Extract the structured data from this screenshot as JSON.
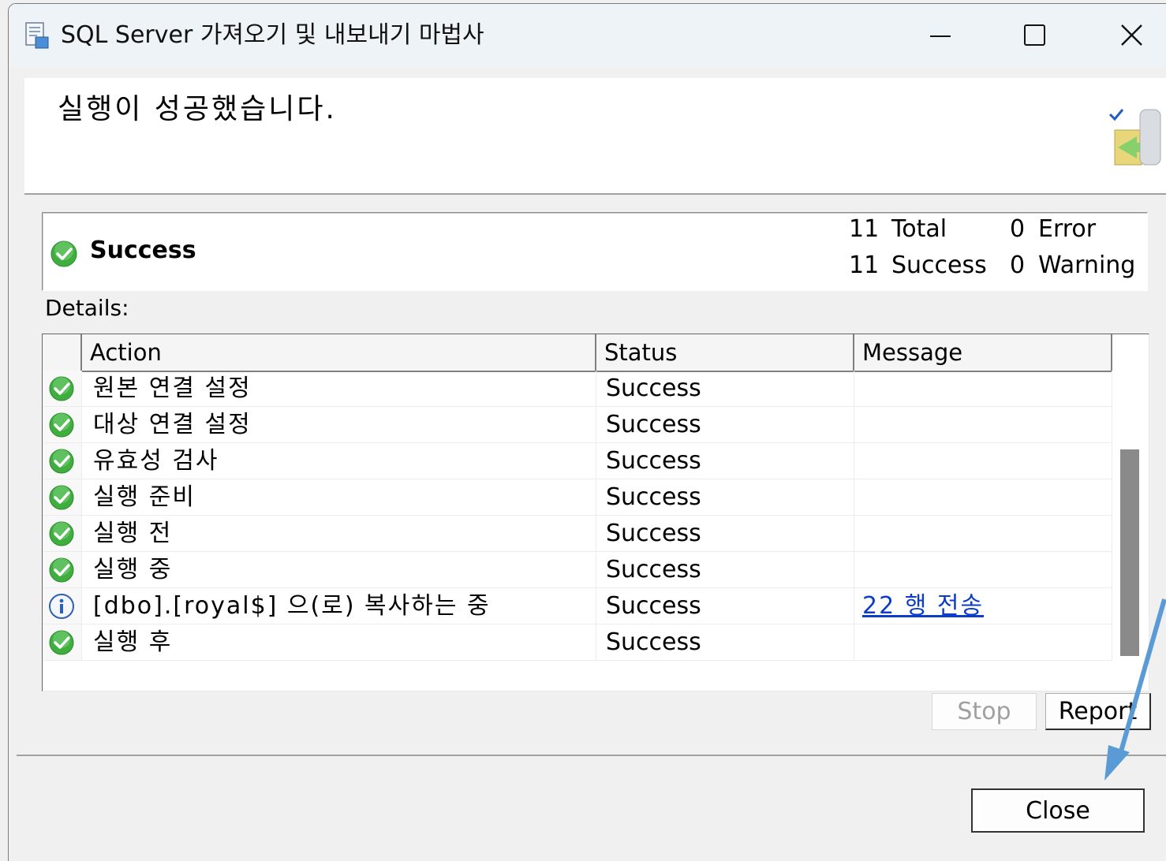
{
  "window": {
    "title": "SQL Server 가져오기 및 내보내기 마법사",
    "controls": {
      "minimize": "minimize-icon",
      "maximize": "maximize-icon",
      "close": "close-icon"
    }
  },
  "header": {
    "title": "실행이 성공했습니다."
  },
  "summary": {
    "status": "Success",
    "total_count": "11",
    "total_label": "Total",
    "success_count": "11",
    "success_label": "Success",
    "error_count": "0",
    "error_label": "Error",
    "warning_count": "0",
    "warning_label": "Warning"
  },
  "details": {
    "label": "Details:",
    "columns": {
      "action": "Action",
      "status": "Status",
      "message": "Message"
    },
    "rows": [
      {
        "icon": "success",
        "action": "원본 연결 설정",
        "status": "Success",
        "message": ""
      },
      {
        "icon": "success",
        "action": "대상 연결 설정",
        "status": "Success",
        "message": ""
      },
      {
        "icon": "success",
        "action": "유효성 검사",
        "status": "Success",
        "message": ""
      },
      {
        "icon": "success",
        "action": "실행 준비",
        "status": "Success",
        "message": ""
      },
      {
        "icon": "success",
        "action": "실행 전",
        "status": "Success",
        "message": ""
      },
      {
        "icon": "success",
        "action": "실행 중",
        "status": "Success",
        "message": ""
      },
      {
        "icon": "info",
        "action": "[dbo].[royal$] 으(로) 복사하는 중",
        "status": "Success",
        "message": "22 행 전송"
      },
      {
        "icon": "success",
        "action": "실행 후",
        "status": "Success",
        "message": ""
      }
    ]
  },
  "buttons": {
    "stop": "Stop",
    "report": "Report",
    "close": "Close"
  },
  "colors": {
    "success_green": "#3fae3f",
    "info_blue": "#2f5fb0",
    "link_blue": "#0b3dc9",
    "annotation_arrow": "#5b9bd5"
  }
}
